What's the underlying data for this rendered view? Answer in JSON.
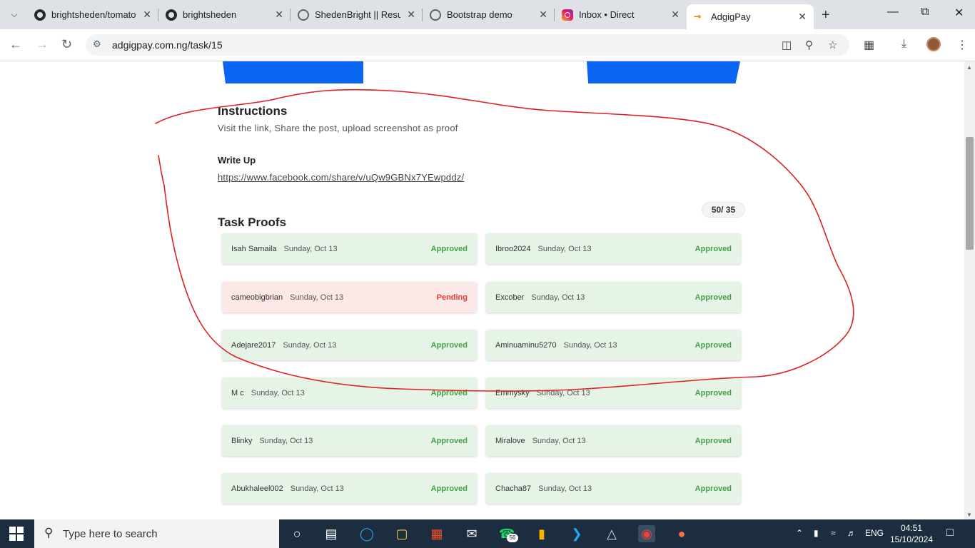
{
  "browser": {
    "tabs": [
      {
        "title": "brightsheden/tomato",
        "favicon": "github-icon"
      },
      {
        "title": "brightsheden",
        "favicon": "github-icon"
      },
      {
        "title": "ShedenBright || Resum",
        "favicon": "globe-icon"
      },
      {
        "title": "Bootstrap demo",
        "favicon": "globe-icon"
      },
      {
        "title": "Inbox • Direct",
        "favicon": "instagram-icon"
      },
      {
        "title": "AdgigPay",
        "favicon": "adgigpay-icon",
        "active": true
      }
    ],
    "url": "adgigpay.com.ng/task/15"
  },
  "page": {
    "instructions_heading": "Instructions",
    "instructions_text": "Visit the link, Share the post, upload screenshot as proof",
    "writeup_heading": "Write Up",
    "writeup_link": "https://www.facebook.com/share/v/uQw9GBNx7YEwpddz/",
    "proofs_heading": "Task Proofs",
    "proofs_count": "50/  35",
    "proofs": [
      {
        "user": "Isah Samaila",
        "date": "Sunday, Oct 13",
        "status": "Approved"
      },
      {
        "user": "Ibroo2024",
        "date": "Sunday, Oct 13",
        "status": "Approved"
      },
      {
        "user": "cameobigbrian",
        "date": "Sunday, Oct 13",
        "status": "Pending"
      },
      {
        "user": "Excober",
        "date": "Sunday, Oct 13",
        "status": "Approved"
      },
      {
        "user": "Adejare2017",
        "date": "Sunday, Oct 13",
        "status": "Approved"
      },
      {
        "user": "Aminuaminu5270",
        "date": "Sunday, Oct 13",
        "status": "Approved"
      },
      {
        "user": "M c",
        "date": "Sunday, Oct 13",
        "status": "Approved"
      },
      {
        "user": "Emmysky",
        "date": "Sunday, Oct 13",
        "status": "Approved"
      },
      {
        "user": "Blinky",
        "date": "Sunday, Oct 13",
        "status": "Approved"
      },
      {
        "user": "Miralove",
        "date": "Sunday, Oct 13",
        "status": "Approved"
      },
      {
        "user": "Abukhaleel002",
        "date": "Sunday, Oct 13",
        "status": "Approved"
      },
      {
        "user": "Chacha87",
        "date": "Sunday, Oct 13",
        "status": "Approved"
      }
    ]
  },
  "colors": {
    "approved_bg": "#e6f4e7",
    "approved_text": "#43a047",
    "pending_bg": "#fde8e8",
    "pending_text": "#e53935",
    "banner_blue": "#0a66f2",
    "annotation_red": "#e02020"
  },
  "taskbar": {
    "search_placeholder": "Type here to search",
    "whatsapp_badge": "56",
    "language": "ENG",
    "time": "04:51",
    "date": "15/10/2024"
  }
}
